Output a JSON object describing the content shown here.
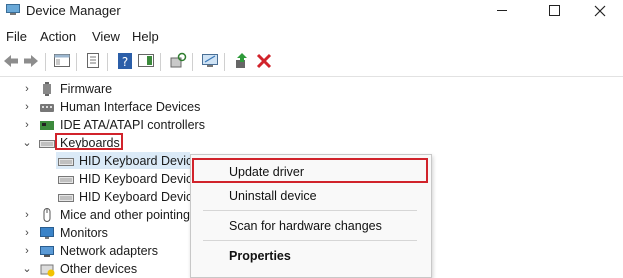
{
  "window": {
    "title": "Device Manager"
  },
  "menu": {
    "file": "File",
    "action": "Action",
    "view": "View",
    "help": "Help"
  },
  "tree": {
    "firmware": "Firmware",
    "hid": "Human Interface Devices",
    "ide": "IDE ATA/ATAPI controllers",
    "keyboards": "Keyboards",
    "kb1": "HID Keyboard Device",
    "kb2": "HID Keyboard Device",
    "kb3": "HID Keyboard Device",
    "mice": "Mice and other pointing",
    "monitors": "Monitors",
    "network": "Network adapters",
    "other": "Other devices"
  },
  "context_menu": {
    "update_driver": "Update driver",
    "uninstall": "Uninstall device",
    "scan": "Scan for hardware changes",
    "properties": "Properties"
  },
  "colors": {
    "highlight_red": "#d1232b",
    "selection_blue": "#dbeaf7"
  }
}
